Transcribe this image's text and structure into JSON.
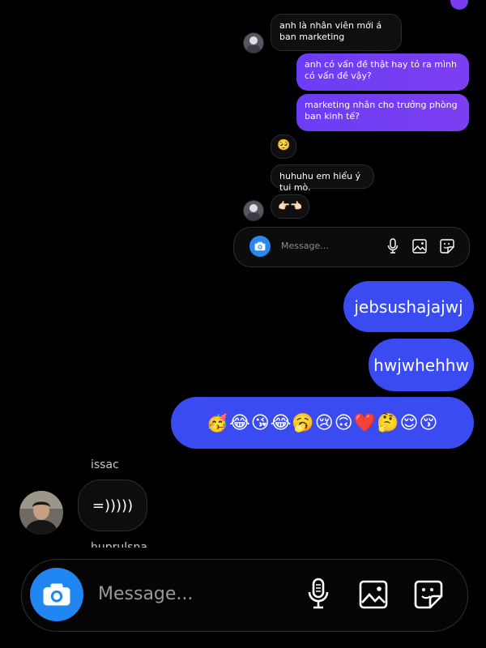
{
  "inset": {
    "messages": [
      {
        "side": "in",
        "text": "anh là nhân viên mới á ban marketing"
      },
      {
        "side": "out",
        "text": "anh có vấn đề thật hay tỏ ra mình có vấn đề vậy?"
      },
      {
        "side": "out",
        "text": "marketing nhắn cho trưởng phòng ban kinh tế?"
      },
      {
        "side": "in",
        "text": "🥺"
      },
      {
        "side": "in",
        "text": "huhuhu em hiểu ý tui mò."
      },
      {
        "side": "in",
        "text": "👉🏻👈🏻"
      }
    ],
    "composer_placeholder": "Message..."
  },
  "chat": {
    "outgoing": [
      {
        "text": "jebsushajajwj"
      },
      {
        "text": "hwjwhehhw"
      },
      {
        "text": "🥳😂😘😂🥱😢🙃❤️🤔😌😚"
      }
    ],
    "sender_name": "issac",
    "incoming_text": "=)))))",
    "cut_off_name": "huprulsna"
  },
  "composer": {
    "placeholder": "Message...",
    "icons": [
      "camera-icon",
      "microphone-icon",
      "image-icon",
      "sticker-icon"
    ]
  },
  "colors": {
    "outgoing_bubble": "#3a4cf1",
    "inset_outgoing": "#6b3df5",
    "camera_button": "#1f86f2"
  }
}
